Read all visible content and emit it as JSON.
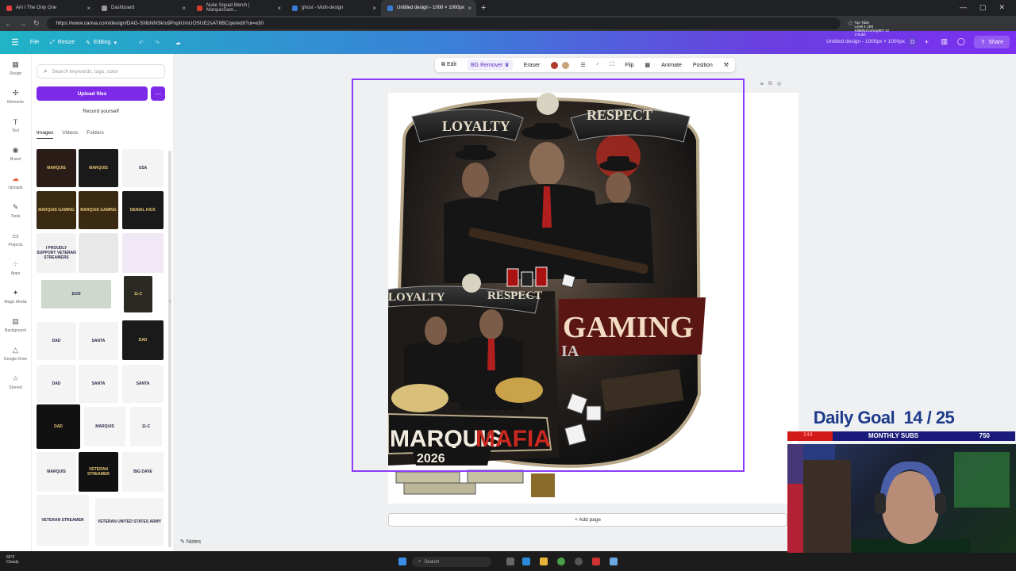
{
  "browser": {
    "tabs": [
      {
        "label": "Am I The Only One",
        "color": "#e23f3f"
      },
      {
        "label": "Dashboard",
        "color": "#999999"
      },
      {
        "label": "Nuke Squad Merch | MarquisGam...",
        "color": "#d33a2c"
      },
      {
        "label": "ghost - Multi-design",
        "color": "#3a7bd5"
      },
      {
        "label": "Untitled design - 1000 × 1000px",
        "color": "#3a7bd5",
        "active": true
      }
    ],
    "url": "https://www.canva.com/design/DAG-SNbNNSk/u9PxpIUmUOSUE2sAT8BCqw/edit?ui=e30"
  },
  "topbar": {
    "file": "File",
    "resize": "Resize",
    "editing": "Editing",
    "title": "Untitled design - 1000px × 1000px",
    "avatar": "D",
    "share": "Share",
    "train": [
      "Top Train",
      "Level 1 (38)",
      "KillBillyGaming907 x2",
      "3 Subs"
    ]
  },
  "rail": [
    {
      "label": "Design",
      "icon": "▦"
    },
    {
      "label": "Elements",
      "icon": "✣"
    },
    {
      "label": "Text",
      "icon": "T"
    },
    {
      "label": "Brand",
      "icon": "◉"
    },
    {
      "label": "Uploads",
      "icon": "☁"
    },
    {
      "label": "Tools",
      "icon": "✎"
    },
    {
      "label": "Projects",
      "icon": "▭"
    },
    {
      "label": "Apps",
      "icon": "⁘"
    },
    {
      "label": "Magic Media",
      "icon": "✦"
    },
    {
      "label": "Background",
      "icon": "▤"
    },
    {
      "label": "Google Drive",
      "icon": "△"
    },
    {
      "label": "Starred",
      "icon": "☆"
    }
  ],
  "panel": {
    "search_placeholder": "Search keywords, tags, color",
    "upload": "Upload files",
    "record": "Record yourself",
    "tabs": [
      "Images",
      "Videos",
      "Folders"
    ]
  },
  "thumbs": [
    "MARQUIS",
    "MARQUIS",
    "USA",
    "MARQUIS GAMING",
    "MARQUIS GAMING",
    "DENIAL KICK",
    "I PROUDLY SUPPORT VETERAN STREAMERS",
    "",
    "",
    "$100",
    "11-C",
    "DAD",
    "SANTA",
    "DAD",
    "DAD",
    "SANTA",
    "SANTA",
    "DAD",
    "MARQUIS",
    "11-C",
    "MARQUIS",
    "VETERAN STREAMER",
    "BIG DAVE",
    "VETERAN STREAMER",
    "VETERAN UNITED STATES ARMY"
  ],
  "context_toolbar": {
    "edit": "Edit",
    "bg_remover": "BG Remover",
    "eraser": "Eraser",
    "colors": [
      "#b03a2e",
      "#c8a27a"
    ],
    "flip": "Flip",
    "animate": "Animate",
    "position": "Position"
  },
  "canvas": {
    "top_left_banner": "LOYALTY",
    "top_right_banner": "RESPECT",
    "mid_left_banner": "LOYALTY",
    "mid_right_banner": "RESPECT",
    "gaming": "GAMING",
    "gaming_sub": "IA",
    "marquis": "MARQUIS",
    "mafia": "MAFIA",
    "year": "2026"
  },
  "add_page": "+ Add page",
  "notes": "Notes",
  "overlay": {
    "goal_label": "Daily Goal",
    "goal_value": "14 / 25",
    "subs_current": "144",
    "subs_label": "MONTHLY SUBS",
    "subs_max": "750"
  },
  "taskbar": {
    "weather": [
      "55°F",
      "Cloudy"
    ],
    "search": "Search"
  }
}
